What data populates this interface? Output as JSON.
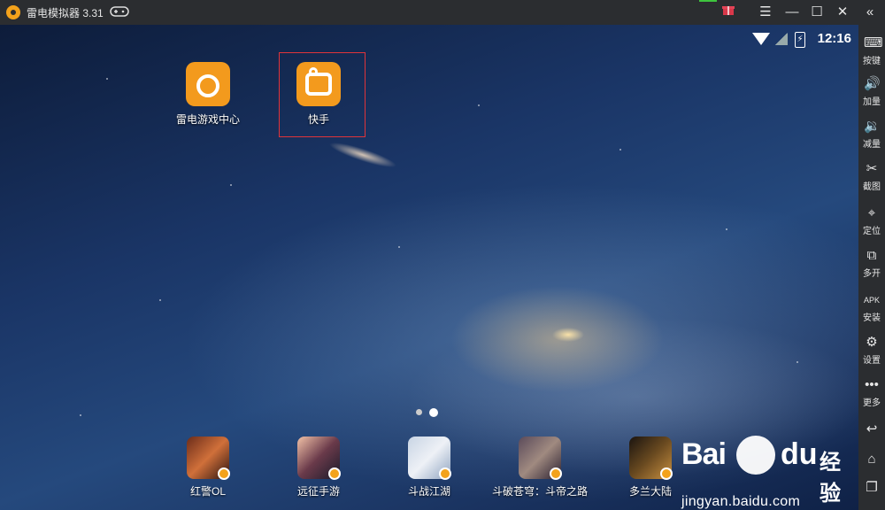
{
  "window": {
    "title": "雷电模拟器 3.31",
    "icons": {
      "logo": "ldplayer-logo-icon",
      "gamepad": "gamepad-icon",
      "gift": "gift-icon",
      "menu": "menu-icon",
      "minimize": "minimize-icon",
      "maximize": "maximize-icon",
      "close": "close-icon",
      "collapse": "double-chevron-left-icon"
    }
  },
  "status_bar": {
    "time": "12:16",
    "icons": [
      "wifi-icon",
      "no-sim-icon",
      "battery-charging-icon"
    ]
  },
  "desktop_apps": [
    {
      "label": "雷电游戏中心",
      "icon": "ld-game-center-icon"
    },
    {
      "label": "快手",
      "icon": "kuaishou-icon"
    }
  ],
  "page_indicator": {
    "pages": 2,
    "current": 2
  },
  "dock_apps": [
    {
      "label": "红警OL"
    },
    {
      "label": "远征手游"
    },
    {
      "label": "斗战江湖"
    },
    {
      "label": "斗破苍穹：斗帝之路"
    },
    {
      "label": "多兰大陆"
    }
  ],
  "toolbar": [
    {
      "label": "按键",
      "icon": "keyboard-icon"
    },
    {
      "label": "加量",
      "icon": "volume-up-icon"
    },
    {
      "label": "减量",
      "icon": "volume-down-icon"
    },
    {
      "label": "截图",
      "icon": "scissors-icon"
    },
    {
      "label": "定位",
      "icon": "location-pin-icon"
    },
    {
      "label": "多开",
      "icon": "multi-instance-icon"
    },
    {
      "label": "安装",
      "icon": "apk-install-icon"
    },
    {
      "label": "设置",
      "icon": "gear-icon"
    },
    {
      "label": "更多",
      "icon": "more-dots-icon"
    }
  ],
  "nav_buttons": [
    "back-icon",
    "home-icon",
    "recent-apps-icon"
  ],
  "watermark": {
    "brand_a": "Bai",
    "brand_b": "du",
    "brand_cn": "经验",
    "url": "jingyan.baidu.com"
  },
  "colors": {
    "accent": "#f39a1d",
    "highlight": "#e0343a",
    "chrome": "#2b2d30"
  }
}
